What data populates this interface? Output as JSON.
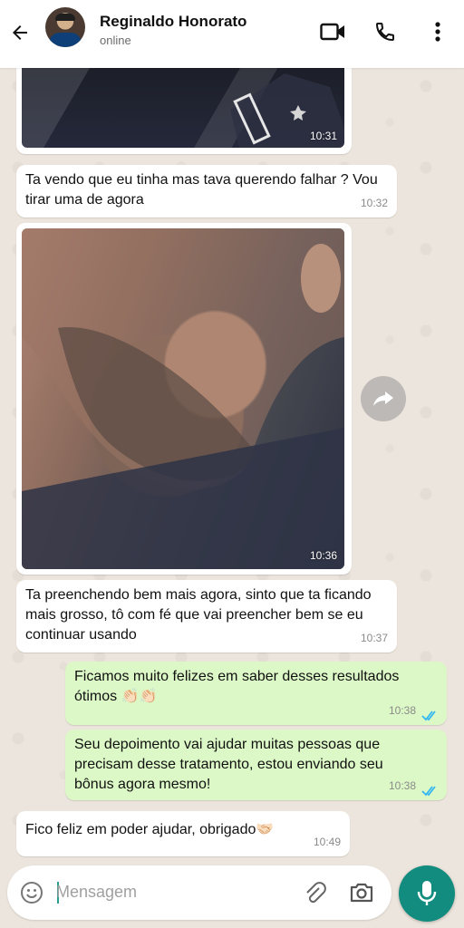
{
  "header": {
    "contact_name": "Reginaldo Honorato",
    "status": "online"
  },
  "messages": [
    {
      "type": "image",
      "direction": "incoming",
      "time": "10:31"
    },
    {
      "type": "text",
      "direction": "incoming",
      "lines": [
        "Ta vendo que eu tinha mas tava querendo falhar ? Vou",
        "tirar uma de agora"
      ],
      "time": "10:32"
    },
    {
      "type": "image",
      "direction": "incoming",
      "time": "10:36"
    },
    {
      "type": "text",
      "direction": "incoming",
      "lines": [
        "Ta preenchendo bem mais agora, sinto que ta ficando",
        "mais grosso, tô com fé que vai preencher bem se eu",
        "continuar usando"
      ],
      "time": "10:37"
    },
    {
      "type": "text",
      "direction": "outgoing",
      "lines": [
        "Ficamos muito felizes em saber desses resultados",
        "ótimos 👏🏻👏🏻"
      ],
      "time": "10:38",
      "ticks": "read"
    },
    {
      "type": "text",
      "direction": "outgoing",
      "lines": [
        "Seu depoimento vai ajudar muitas pessoas que",
        "precisam desse tratamento, estou enviando seu",
        "bônus agora mesmo!"
      ],
      "time": "10:38",
      "ticks": "read"
    },
    {
      "type": "text",
      "direction": "incoming",
      "lines": [
        "Fico feliz em poder ajudar, obrigado🤝🏻"
      ],
      "time": "10:49"
    }
  ],
  "composer": {
    "placeholder": "Mensagem"
  },
  "icons": {
    "back": "arrow-left-icon",
    "video": "video-call-icon",
    "call": "phone-icon",
    "menu": "more-vert-icon",
    "forward": "forward-icon",
    "emoji": "emoji-icon",
    "attach": "paperclip-icon",
    "camera": "camera-icon",
    "mic": "microphone-icon"
  },
  "colors": {
    "outgoing_bubble": "#dcf8c6",
    "incoming_bubble": "#ffffff",
    "accent": "#128c7e",
    "read_ticks": "#34b7f1"
  }
}
